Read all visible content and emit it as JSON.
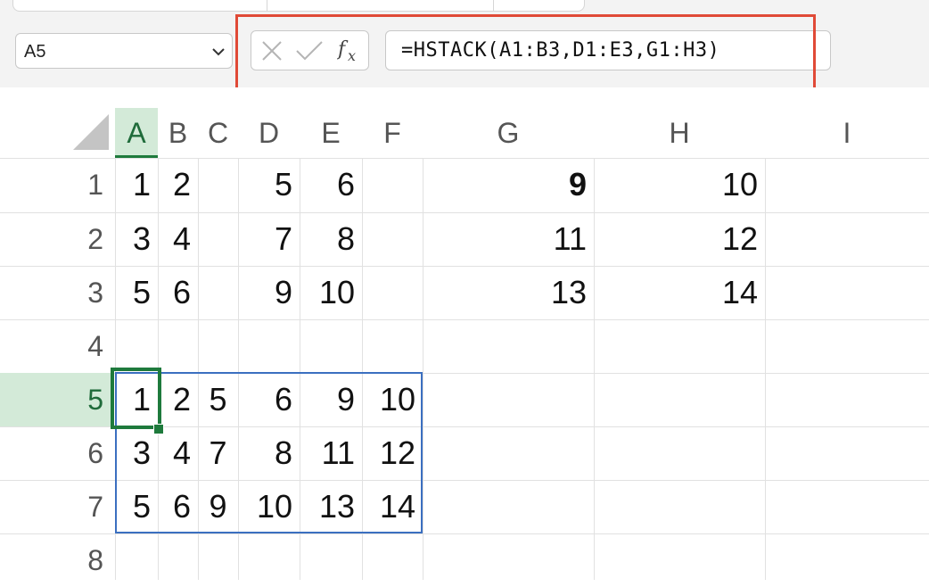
{
  "name_box": {
    "value": "A5"
  },
  "formula_bar": {
    "cancel_icon": "x-icon",
    "enter_icon": "check-icon",
    "function_icon": "fx-icon",
    "formula": "=HSTACK(A1:B3,D1:E3,G1:H3)"
  },
  "columns": [
    {
      "label": "A",
      "selected": true
    },
    {
      "label": "B",
      "selected": false
    },
    {
      "label": "C",
      "selected": false
    },
    {
      "label": "D",
      "selected": false
    },
    {
      "label": "E",
      "selected": false
    },
    {
      "label": "F",
      "selected": false
    },
    {
      "label": "G",
      "selected": false
    },
    {
      "label": "H",
      "selected": false
    },
    {
      "label": "I",
      "selected": false
    }
  ],
  "rows": [
    "1",
    "2",
    "3",
    "4",
    "5",
    "6",
    "7",
    "8"
  ],
  "selected_row": "5",
  "cells": [
    {
      "ref": "A1",
      "value": "1"
    },
    {
      "ref": "B1",
      "value": "2"
    },
    {
      "ref": "D1",
      "value": "5"
    },
    {
      "ref": "E1",
      "value": "6"
    },
    {
      "ref": "G1",
      "value": "9",
      "bold": true
    },
    {
      "ref": "H1",
      "value": "10"
    },
    {
      "ref": "A2",
      "value": "3"
    },
    {
      "ref": "B2",
      "value": "4"
    },
    {
      "ref": "D2",
      "value": "7"
    },
    {
      "ref": "E2",
      "value": "8"
    },
    {
      "ref": "G2",
      "value": "11"
    },
    {
      "ref": "H2",
      "value": "12"
    },
    {
      "ref": "A3",
      "value": "5"
    },
    {
      "ref": "B3",
      "value": "6"
    },
    {
      "ref": "D3",
      "value": "9"
    },
    {
      "ref": "E3",
      "value": "10"
    },
    {
      "ref": "G3",
      "value": "13"
    },
    {
      "ref": "H3",
      "value": "14"
    },
    {
      "ref": "A5",
      "value": "1"
    },
    {
      "ref": "B5",
      "value": "2"
    },
    {
      "ref": "C5",
      "value": "5"
    },
    {
      "ref": "D5",
      "value": "6"
    },
    {
      "ref": "E5",
      "value": "9"
    },
    {
      "ref": "F5",
      "value": "10"
    },
    {
      "ref": "A6",
      "value": "3"
    },
    {
      "ref": "B6",
      "value": "4"
    },
    {
      "ref": "C6",
      "value": "7"
    },
    {
      "ref": "D6",
      "value": "8"
    },
    {
      "ref": "E6",
      "value": "11"
    },
    {
      "ref": "F6",
      "value": "12"
    },
    {
      "ref": "A7",
      "value": "5"
    },
    {
      "ref": "B7",
      "value": "6"
    },
    {
      "ref": "C7",
      "value": "9"
    },
    {
      "ref": "D7",
      "value": "10"
    },
    {
      "ref": "E7",
      "value": "13"
    },
    {
      "ref": "F7",
      "value": "14"
    }
  ],
  "colors": {
    "active_cell_border": "#1e7a3c",
    "spill_border": "#3b6fc0",
    "highlight_box": "#e04a37",
    "selected_header_bg": "#d3ead8"
  }
}
